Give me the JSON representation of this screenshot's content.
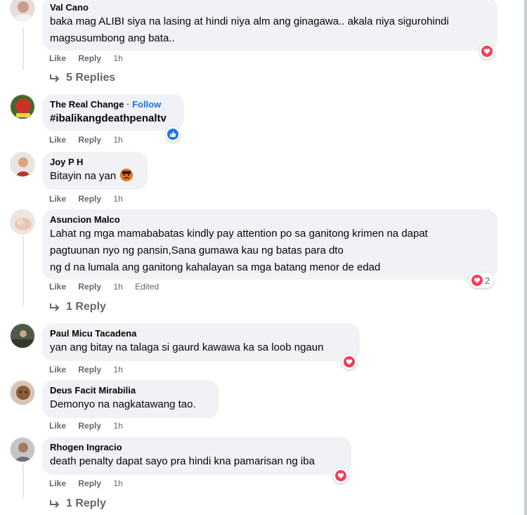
{
  "comments": [
    {
      "author": "Val Cano",
      "text_lines": [
        "baka mag ALIBI siya na lasing at hindi niya alm ang ginagawa.. akala niya sigurohindi",
        "magsusumbong ang bata.."
      ],
      "like": "Like",
      "reply": "Reply",
      "time": "1h",
      "reaction": "heart-icon",
      "replies_label": "5 Replies"
    },
    {
      "author": "The Real Change",
      "separator": "·",
      "follow": "Follow",
      "text_lines": [
        "#ibalikangdeathpenaltv"
      ],
      "like": "Like",
      "reply": "Reply",
      "time": "1h",
      "reaction": "like-icon"
    },
    {
      "author": "Joy P H",
      "text_lines": [
        "Bitayin na yan"
      ],
      "emoji": "angry-face-icon",
      "like": "Like",
      "reply": "Reply",
      "time": "1h"
    },
    {
      "author": "Asuncion Malco",
      "text_lines": [
        "Lahat ng mga mamababatas kindly pay attention po sa ganitong krimen na dapat",
        "pagtuunan nyo ng pansin,Sana gumawa kau ng batas para dto",
        "ng d na lumala ang ganitong kahalayan sa mga batang menor de edad"
      ],
      "like": "Like",
      "reply": "Reply",
      "time": "1h",
      "edited": "Edited",
      "reaction": "heart-icon",
      "reaction_count": "2",
      "replies_label": "1 Reply"
    },
    {
      "author": "Paul Micu Tacadena",
      "text_lines": [
        "yan ang bitay na talaga si gaurd kawawa ka sa loob ngaun"
      ],
      "like": "Like",
      "reply": "Reply",
      "time": "1h",
      "reaction": "heart-icon"
    },
    {
      "author": "Deus Facit Mirabilia",
      "text_lines": [
        "Demonyo na nagkatawang tao."
      ],
      "like": "Like",
      "reply": "Reply",
      "time": "1h"
    },
    {
      "author": "Rhogen Ingracio",
      "text_lines": [
        "death penalty dapat sayo pra hindi kna pamarisan ng iba"
      ],
      "like": "Like",
      "reply": "Reply",
      "time": "1h",
      "reaction": "heart-icon",
      "replies_label": "1 Reply"
    }
  ],
  "colors": {
    "bubble": "#f0f2f5",
    "secondary_text": "#65676b",
    "follow_link": "#1b74e4",
    "heart": "#f33e58",
    "like": "#1877f2"
  }
}
